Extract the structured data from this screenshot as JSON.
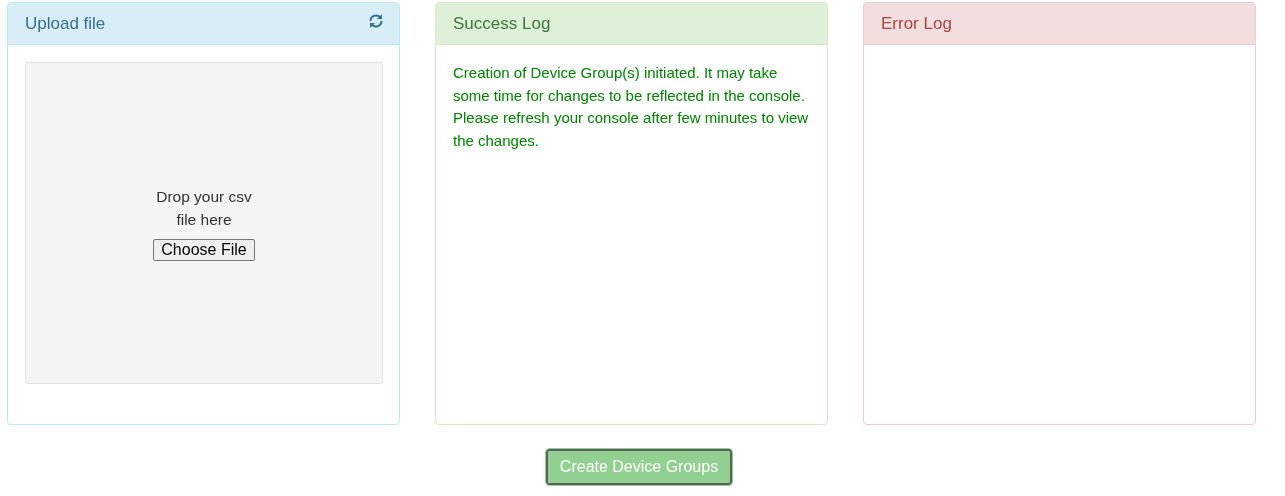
{
  "panels": [
    {
      "kind": "upload",
      "title": "Upload file",
      "drop_text": "Drop your csv file here",
      "choose_button": "Choose File"
    },
    {
      "kind": "success",
      "title": "Success Log",
      "message": "Creation of Device Group(s) initiated. It may take some time for changes to be reflected in the console. Please refresh your console after few minutes to view the changes."
    },
    {
      "kind": "error",
      "title": "Error Log"
    }
  ],
  "create_button": "Create Device Groups"
}
